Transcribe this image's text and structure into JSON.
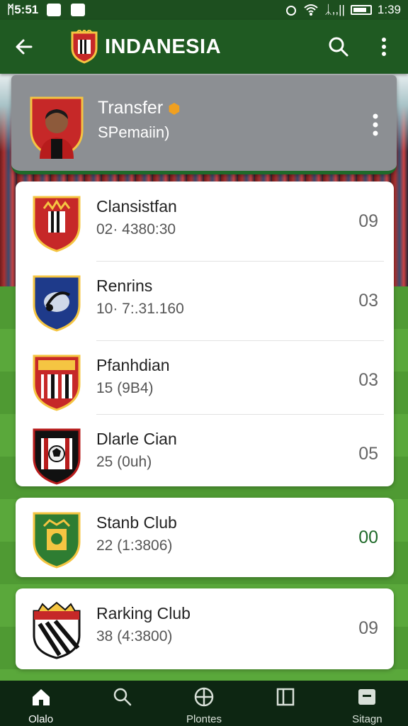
{
  "status_bar": {
    "left_time": "ᛗ5:51",
    "right_time": "1:39",
    "right_label": "ᛣ,,||"
  },
  "app_bar": {
    "title": "INDANESIA",
    "back_icon": "arrow-left-icon",
    "search_icon": "search-icon",
    "more_icon": "more-vertical-icon",
    "crest_icon": "club-crest-icon"
  },
  "hero": {
    "title": "Transfer",
    "badge_icon": "verified-badge-icon",
    "subtitle": "SPemaiin)"
  },
  "clubs": [
    {
      "name": "Clansistfan",
      "meta": "02· 4380:30",
      "value": "09",
      "crest_colors": [
        "#c62828",
        "#f5c542"
      ]
    },
    {
      "name": "Renrins",
      "meta": "10· 7:.31.160",
      "value": "03",
      "crest_colors": [
        "#1e3a8a",
        "#f5c542"
      ]
    },
    {
      "name": "Pfanhdian",
      "meta": "15 (9B4)",
      "value": "03",
      "crest_colors": [
        "#c62828",
        "#ffffff"
      ]
    },
    {
      "name": "Dlarle Cian",
      "meta": "25 (0uh)",
      "value": "05",
      "crest_colors": [
        "#b71c1c",
        "#111111"
      ]
    },
    {
      "name": "Stanb Club",
      "meta": "22 (1:3806)",
      "value": "00",
      "crest_colors": [
        "#2e7d32",
        "#f5c542"
      ],
      "value_highlight": true
    },
    {
      "name": "Rarking Club",
      "meta": "38 (4:3800)",
      "value": "09",
      "crest_colors": [
        "#111111",
        "#c62828"
      ]
    }
  ],
  "bottom_nav": [
    {
      "label": "Olalo",
      "icon": "home-icon",
      "active": true
    },
    {
      "label": "",
      "icon": "search-icon",
      "active": false
    },
    {
      "label": "Plontes",
      "icon": "crosshair-icon",
      "active": false
    },
    {
      "label": "",
      "icon": "book-icon",
      "active": false
    },
    {
      "label": "Sitagn",
      "icon": "profile-card-icon",
      "active": false
    }
  ],
  "colors": {
    "primary": "#1f5a22",
    "nav_bg": "#0d2612",
    "card_bg": "#ffffff",
    "hero_bg": "#8c8f93",
    "accent_badge": "#f0a020"
  }
}
